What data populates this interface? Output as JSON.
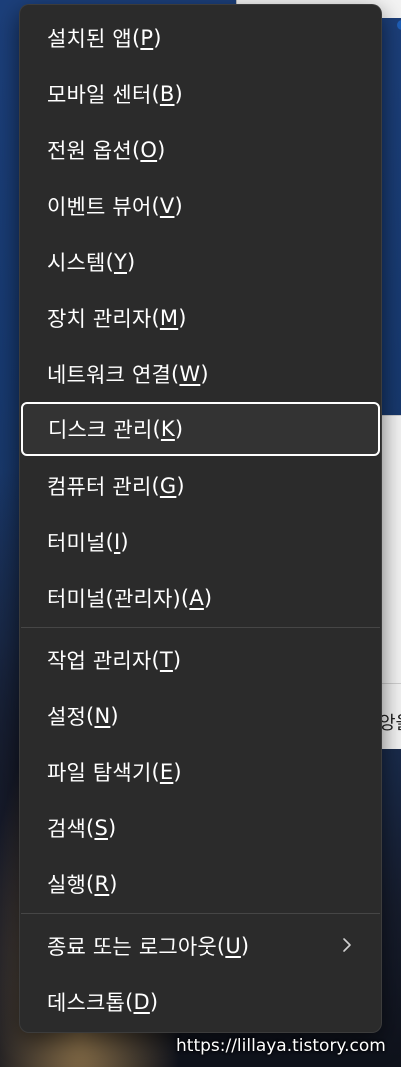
{
  "menu": {
    "group1": [
      {
        "label": "설치된 앱",
        "key": "P"
      },
      {
        "label": "모바일 센터",
        "key": "B"
      },
      {
        "label": "전원 옵션",
        "key": "O"
      },
      {
        "label": "이벤트 뷰어",
        "key": "V"
      },
      {
        "label": "시스템",
        "key": "Y"
      },
      {
        "label": "장치 관리자",
        "key": "M"
      },
      {
        "label": "네트워크 연결",
        "key": "W"
      },
      {
        "label": "디스크 관리",
        "key": "K"
      },
      {
        "label": "컴퓨터 관리",
        "key": "G"
      },
      {
        "label": "터미널",
        "key": "I"
      },
      {
        "label": "터미널(관리자)",
        "key": "A"
      }
    ],
    "group2": [
      {
        "label": "작업 관리자",
        "key": "T"
      },
      {
        "label": "설정",
        "key": "N"
      },
      {
        "label": "파일 탐색기",
        "key": "E"
      },
      {
        "label": "검색",
        "key": "S"
      },
      {
        "label": "실행",
        "key": "R"
      }
    ],
    "group3": [
      {
        "label": "종료 또는 로그아웃",
        "key": "U",
        "has_submenu": true,
        "icon": "chevron-right-icon"
      },
      {
        "label": "데스크톱",
        "key": "D"
      }
    ],
    "focused_item": "디스크 관리"
  },
  "background": {
    "partial_text": "앙을"
  },
  "watermark": "https://lillaya.tistory.com",
  "colors": {
    "menu_bg": "#2b2b2b",
    "focus_border": "#ffffff",
    "text": "#ffffff",
    "divider": "#464646"
  }
}
